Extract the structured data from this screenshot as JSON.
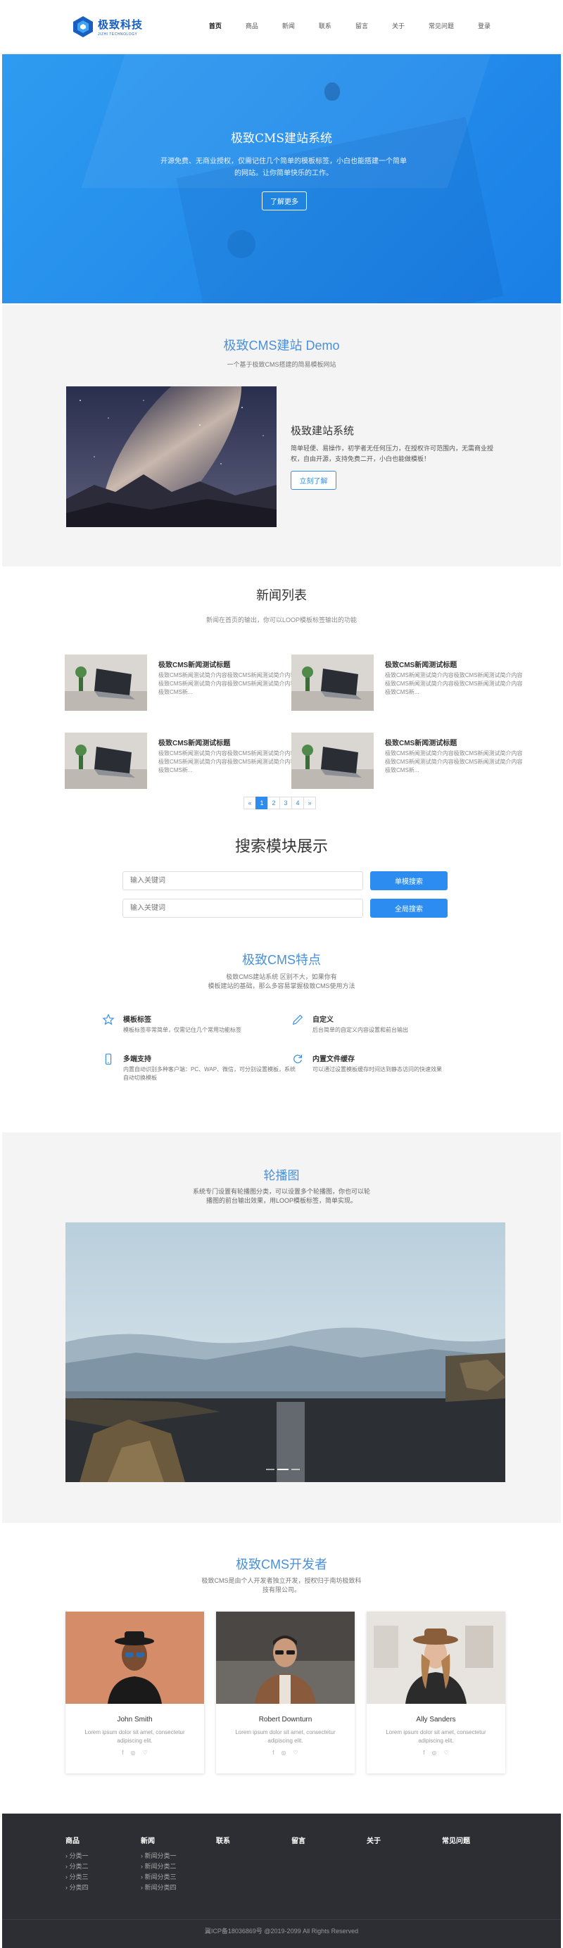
{
  "header": {
    "logo_cn": "极致科技",
    "logo_en": "JIZHI TECHNOLOGY",
    "nav": [
      "首页",
      "商品",
      "新闻",
      "联系",
      "留言",
      "关于",
      "常见问题",
      "登录"
    ],
    "active": 0
  },
  "hero": {
    "title": "极致CMS建站系统",
    "desc": "开源免费、无商业授权，仅需记住几个简单的模板标签，小白也能搭建一个简单的网站。让你简单快乐的工作。",
    "button": "了解更多",
    "colors": {
      "bg": "#2e9bf0"
    }
  },
  "demo": {
    "title": "极致CMS建站 Demo",
    "subtitle": "一个基于极致CMS搭建的简易模板网站",
    "heading": "极致建站系统",
    "text": "简单轻便、易操作，初学者无任何压力，在授权许可范围内，无需商业授权，自由开源，支持免费二开，小白也能做模板！",
    "button": "立刻了解"
  },
  "news": {
    "title": "新闻列表",
    "subtitle": "新闻在首页的输出，你可以LOOP模板标签输出的功能",
    "items": [
      {
        "title": "极致CMS新闻测试标题",
        "text": "极致CMS新闻测试简介内容极致CMS新闻测试简介内容极致CMS新闻测试简介内容极致CMS新闻测试简介内容极致CMS新..."
      },
      {
        "title": "极致CMS新闻测试标题",
        "text": "极致CMS新闻测试简介内容极致CMS新闻测试简介内容极致CMS新闻测试简介内容极致CMS新闻测试简介内容极致CMS新..."
      },
      {
        "title": "极致CMS新闻测试标题",
        "text": "极致CMS新闻测试简介内容极致CMS新闻测试简介内容极致CMS新闻测试简介内容极致CMS新闻测试简介内容极致CMS新..."
      },
      {
        "title": "极致CMS新闻测试标题",
        "text": "极致CMS新闻测试简介内容极致CMS新闻测试简介内容极致CMS新闻测试简介内容极致CMS新闻测试简介内容极致CMS新..."
      }
    ],
    "pager": [
      "«",
      "1",
      "2",
      "3",
      "4",
      "»"
    ],
    "current_page": "1"
  },
  "search": {
    "title": "搜索模块展示",
    "placeholder1": "输入关键词",
    "button1": "单模搜索",
    "placeholder2": "输入关键词",
    "button2": "全局搜索"
  },
  "features": {
    "title": "极致CMS特点",
    "subtitle_line1": "极致CMS建站系统     区别不大，如果你有",
    "subtitle_line2": "模板建站的基础，那么多容易掌握极致CMS使用方法",
    "items": [
      {
        "title": "模板标签",
        "text": "模板标签非常简单，仅需记住几个常用功能标签"
      },
      {
        "title": "自定义",
        "text": "后台简单的自定义内容设置和前台输出"
      },
      {
        "title": "多端支持",
        "text": "内置自动识别多种客户端：PC、WAP、微信，可分别设置模板，系统自动切换模板"
      },
      {
        "title": "内置文件缓存",
        "text": "可以通过设置模板缓存时间达到静态访问的快速效果"
      }
    ],
    "icons": [
      "star-icon",
      "pencil-icon",
      "phone-icon",
      "refresh-icon"
    ]
  },
  "carousel": {
    "title": "轮播图",
    "subtitle_line1": "系统专门设置有轮播图分类，可以设置多个轮播图，你也可以轮",
    "subtitle_line2": "播图的前台输出效果，用LOOP模板标签，简单实现。",
    "slides": 3,
    "active_slide": 2
  },
  "team": {
    "title": "极致CMS开发者",
    "subtitle_line1": "极致CMS是由个人开发者独立开发，授权归于南坊极致科",
    "subtitle_line2": "技有限公司。",
    "members": [
      {
        "name": "John Smith",
        "desc": "Lorem ipsum dolor sit amet, consectetur adipiscing elit."
      },
      {
        "name": "Robert Downturn",
        "desc": "Lorem ipsum dolor sit amet, consectetur adipiscing elit."
      },
      {
        "name": "Ally Sanders",
        "desc": "Lorem ipsum dolor sit amet, consectetur adipiscing elit."
      }
    ],
    "social": [
      "f",
      "◎",
      "♡"
    ]
  },
  "footer": {
    "columns": [
      {
        "title": "商品",
        "links": [
          "分类一",
          "分类二",
          "分类三",
          "分类四"
        ]
      },
      {
        "title": "新闻",
        "links": [
          "新闻分类一",
          "新闻分类二",
          "新闻分类三",
          "新闻分类四"
        ]
      },
      {
        "title": "联系",
        "links": []
      },
      {
        "title": "留言",
        "links": []
      },
      {
        "title": "关于",
        "links": []
      },
      {
        "title": "常见问题",
        "links": []
      }
    ],
    "copyright": "冀ICP备18036869号 @2019-2099 All Rights Reserved"
  }
}
